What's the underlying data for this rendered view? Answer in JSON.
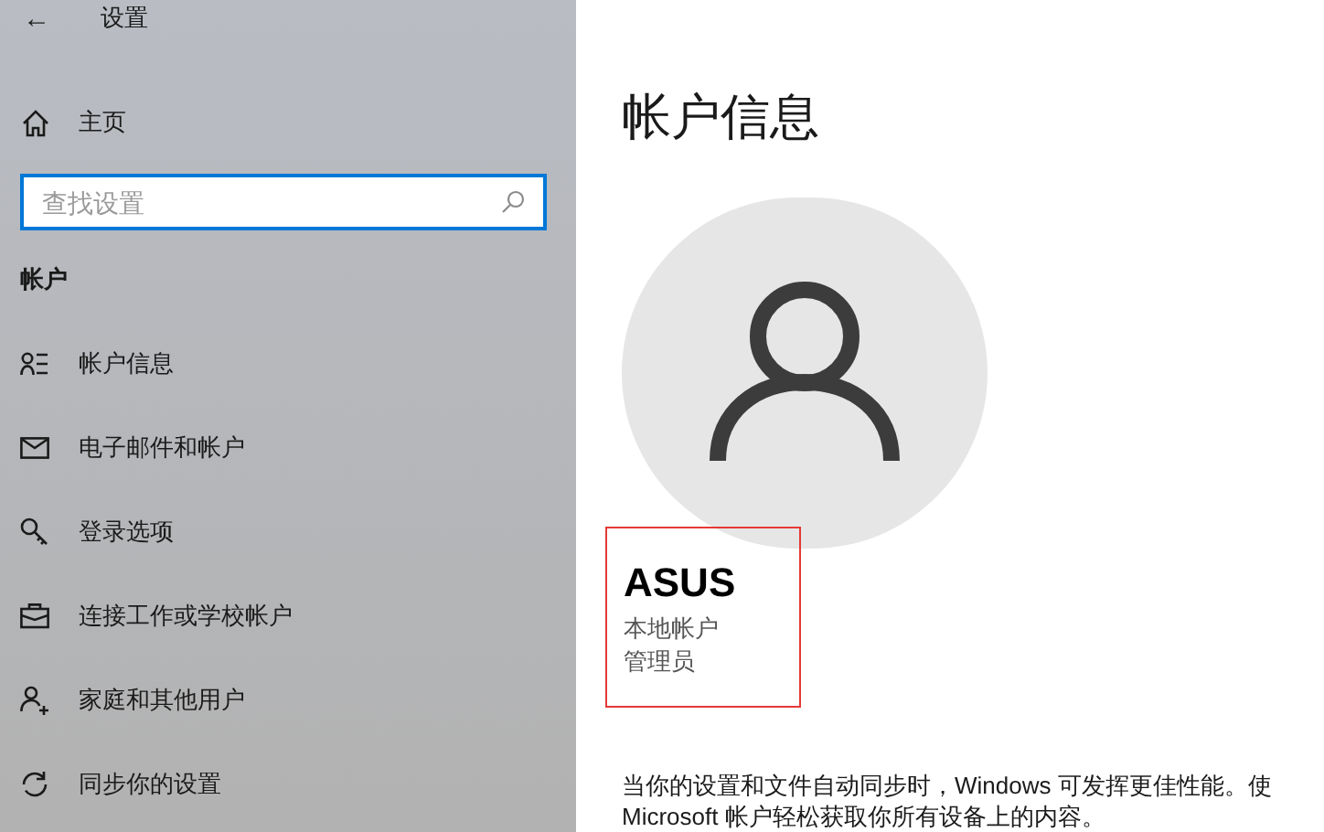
{
  "window": {
    "title": "设置",
    "back": "←"
  },
  "sidebar": {
    "home": "主页",
    "search": {
      "placeholder": "查找设置"
    },
    "section": "帐户",
    "items": [
      {
        "label": "帐户信息"
      },
      {
        "label": "电子邮件和帐户"
      },
      {
        "label": "登录选项"
      },
      {
        "label": "连接工作或学校帐户"
      },
      {
        "label": "家庭和其他用户"
      },
      {
        "label": "同步你的设置"
      }
    ]
  },
  "main": {
    "heading": "帐户信息",
    "user": {
      "name": "ASUS",
      "type": "本地帐户",
      "role": "管理员",
      "highlighted": true
    },
    "description": [
      "当你的设置和文件自动同步时，Windows 可发挥更佳性能。使",
      "Microsoft 帐户轻松获取你所有设备上的内容。"
    ]
  }
}
